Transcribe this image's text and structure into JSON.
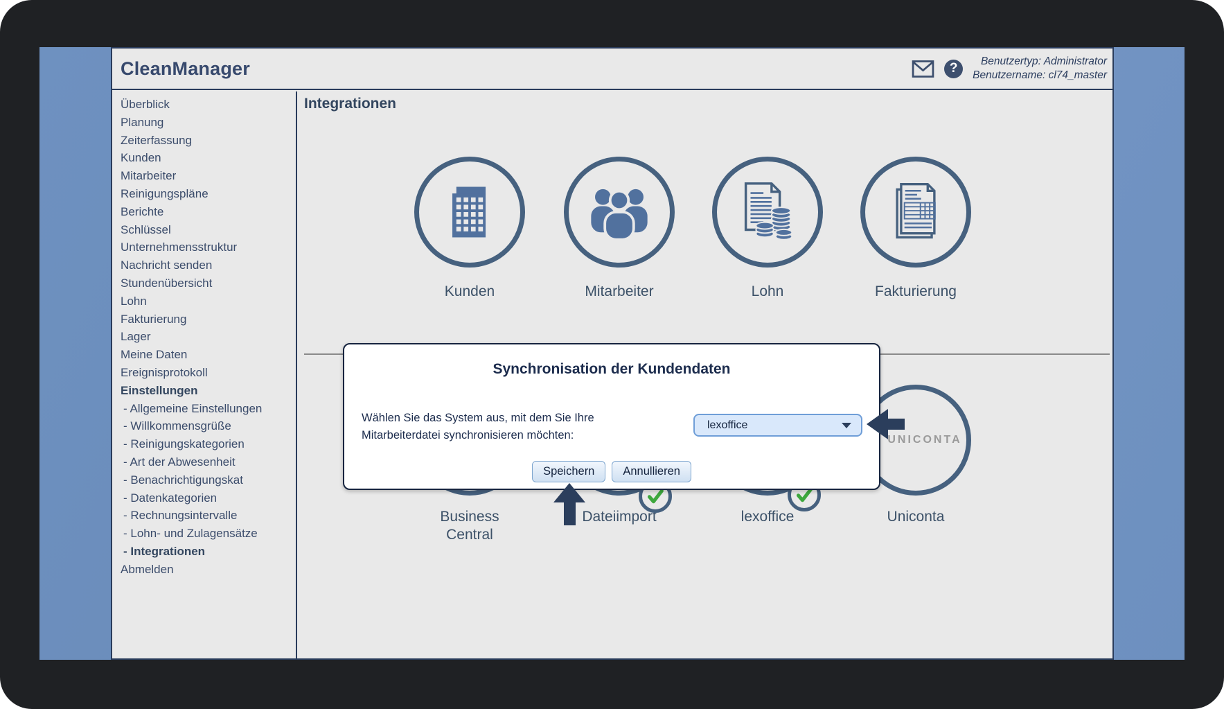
{
  "header": {
    "app_title": "CleanManager",
    "icons": [
      "mail-icon",
      "help-icon"
    ],
    "help_glyph": "?",
    "user_type": "Benutzertyp: Administrator",
    "user_name": "Benutzername: cl74_master"
  },
  "sidebar": {
    "items": [
      {
        "label": "Überblick"
      },
      {
        "label": "Planung"
      },
      {
        "label": "Zeiterfassung"
      },
      {
        "label": "Kunden"
      },
      {
        "label": "Mitarbeiter"
      },
      {
        "label": "Reinigungspläne"
      },
      {
        "label": "Berichte"
      },
      {
        "label": "Schlüssel"
      },
      {
        "label": "Unternehmensstruktur"
      },
      {
        "label": "Nachricht senden"
      },
      {
        "label": "Stundenübersicht"
      },
      {
        "label": "Lohn"
      },
      {
        "label": "Fakturierung"
      },
      {
        "label": "Lager"
      },
      {
        "label": "Meine Daten"
      },
      {
        "label": "Ereignisprotokoll"
      },
      {
        "label": "Einstellungen",
        "bold": true
      },
      {
        "label": "- Allgemeine Einstellungen",
        "indent": true
      },
      {
        "label": "- Willkommensgrüße",
        "indent": true
      },
      {
        "label": "- Reinigungskategorien",
        "indent": true
      },
      {
        "label": "- Art der Abwesenheit",
        "indent": true
      },
      {
        "label": "- Benachrichtigungskat",
        "indent": true
      },
      {
        "label": "- Datenkategorien",
        "indent": true
      },
      {
        "label": "- Rechnungsintervalle",
        "indent": true
      },
      {
        "label": "- Lohn- und Zulagensätze",
        "indent": true
      },
      {
        "label": "- Integrationen",
        "indent": true,
        "bold": true
      },
      {
        "label": "Abmelden"
      }
    ]
  },
  "main": {
    "title": "Integrationen",
    "top_integrations": [
      {
        "label": "Kunden",
        "icon": "building-icon"
      },
      {
        "label": "Mitarbeiter",
        "icon": "team-icon"
      },
      {
        "label": "Lohn",
        "icon": "payroll-coins-icon"
      },
      {
        "label": "Fakturierung",
        "icon": "invoice-icon"
      }
    ],
    "bottom_integrations": [
      {
        "label": "Business Central",
        "synced": false
      },
      {
        "label": "Dateiimport",
        "synced": true
      },
      {
        "label": "lexoffice",
        "synced": true
      },
      {
        "label": "Uniconta",
        "synced": false,
        "logo": "UNICONTA"
      }
    ]
  },
  "modal": {
    "title": "Synchronisation der Kundendaten",
    "body_line1": "Wählen Sie das System aus, mit dem Sie Ihre",
    "body_line2": "Mitarbeiterdatei synchronisieren möchten:",
    "dropdown": {
      "value": "lexoffice"
    },
    "save_label": "Speichern",
    "cancel_label": "Annullieren"
  },
  "colors": {
    "accent_navy": "#2b3e5c",
    "circle_stroke": "#46617f",
    "icon_fill": "#51719e",
    "wallpaper_blue": "#6d90bf",
    "app_bg": "#e9e9e9",
    "dropdown_bg": "#d9e8fb",
    "dropdown_border": "#6f9ed8",
    "check_green": "#3ea83e"
  }
}
